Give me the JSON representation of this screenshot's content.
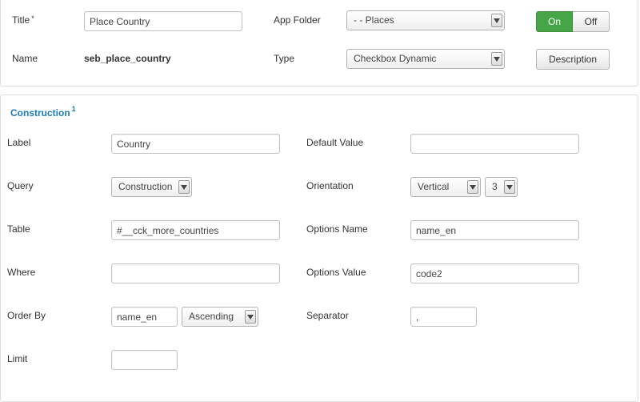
{
  "header": {
    "title_label": "Title",
    "required_mark": "*",
    "title_value": "Place Country",
    "app_folder_label": "App Folder",
    "app_folder_value": "- - Places",
    "state_on": "On",
    "state_off": "Off",
    "state_active": "On",
    "name_label": "Name",
    "name_value": "seb_place_country",
    "type_label": "Type",
    "type_value": "Checkbox Dynamic",
    "description_button": "Description"
  },
  "construction": {
    "title": "Construction",
    "title_sup": "1",
    "label_label": "Label",
    "label_value": "Country",
    "default_value_label": "Default Value",
    "default_value": "",
    "query_label": "Query",
    "query_value": "Construction",
    "orientation_label": "Orientation",
    "orientation_value": "Vertical",
    "orientation_columns": "3",
    "table_label": "Table",
    "table_value": "#__cck_more_countries",
    "options_name_label": "Options Name",
    "options_name_value": "name_en",
    "where_label": "Where",
    "where_value": "",
    "options_value_label": "Options Value",
    "options_value_value": "code2",
    "order_by_label": "Order By",
    "order_by_field": "name_en",
    "order_by_direction": "Ascending",
    "separator_label": "Separator",
    "separator_value": ",",
    "limit_label": "Limit",
    "limit_value": ""
  },
  "colors": {
    "accent_green": "#46a546",
    "section_title_blue": "#1a7ab4"
  }
}
